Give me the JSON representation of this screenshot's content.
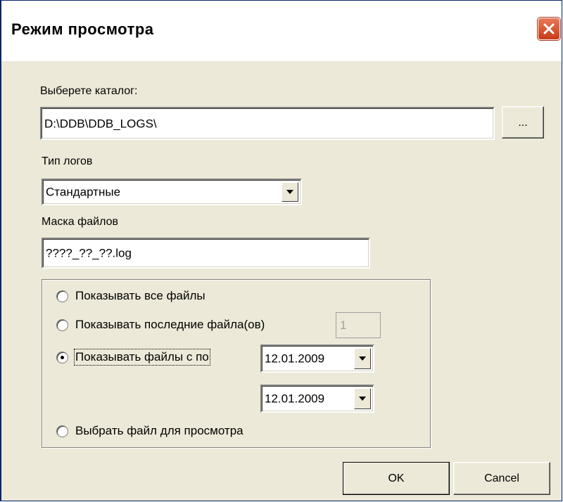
{
  "window": {
    "title": "Режим просмотра",
    "close_icon": "close-icon"
  },
  "folder": {
    "label": "Выберете каталог:",
    "value": "D:\\DDB\\DDB_LOGS\\",
    "browse_label": "..."
  },
  "log_type": {
    "label": "Тип логов",
    "selected": "Стандартные"
  },
  "file_mask": {
    "label": "Маска файлов",
    "value": "????_??_??.log"
  },
  "mode": {
    "options": [
      {
        "label": "Показывать все файлы",
        "selected": false
      },
      {
        "label": "Показывать последние файла(ов)",
        "selected": false
      },
      {
        "label": "Показывать файлы с по",
        "selected": true
      },
      {
        "label": "Выбрать файл для просмотра",
        "selected": false
      }
    ],
    "last_count": "1",
    "date_from": "12.01.2009",
    "date_to": "12.01.2009"
  },
  "buttons": {
    "ok": "OK",
    "cancel": "Cancel"
  },
  "colors": {
    "dialog_bg": "#ece9d8",
    "border_blue": "#0a246a",
    "close_red": "#c83c18"
  }
}
